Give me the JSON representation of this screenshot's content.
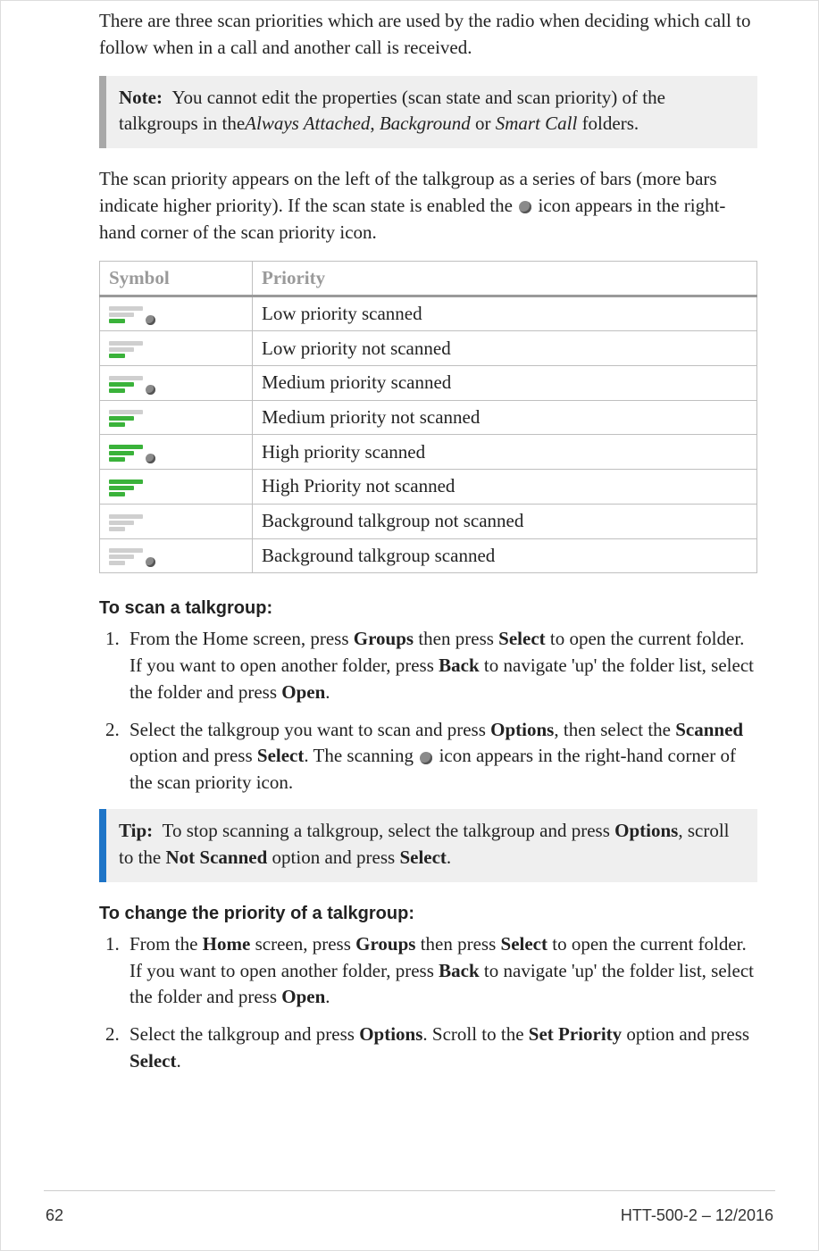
{
  "intro": "There are three scan priorities which are used by the radio when deciding which call to follow when in a call and another call is received.",
  "note": {
    "label": "Note:",
    "text_pre": "You cannot edit the properties (scan state and scan priority) of the talkgroups in the",
    "i1": "Always Attached",
    "sep1": ", ",
    "i2": "Background",
    "sep2": " or ",
    "i3": "Smart Call",
    "text_post": " folders."
  },
  "para2_a": "The scan priority appears on the left of the talkgroup as a series of bars (more bars indicate higher priority). If the scan state is enabled the ",
  "para2_b": " icon appears in the right-hand corner of the scan priority icon.",
  "table": {
    "h1": "Symbol",
    "h2": "Priority",
    "rows": [
      {
        "label": "Low priority scanned"
      },
      {
        "label": "Low priority not scanned"
      },
      {
        "label": "Medium priority scanned"
      },
      {
        "label": "Medium priority not scanned"
      },
      {
        "label": "High priority scanned"
      },
      {
        "label": "High Priority not scanned"
      },
      {
        "label": "Background talkgroup not scanned"
      },
      {
        "label": "Background talkgroup scanned"
      }
    ]
  },
  "scan_heading": "To scan a talkgroup:",
  "scan_steps": {
    "s1_a": "From the Home screen, press ",
    "s1_b1": "Groups",
    "s1_c": " then press ",
    "s1_b2": "Select",
    "s1_d": " to open the current folder. If you want to open another folder, press ",
    "s1_b3": "Back",
    "s1_e": " to navigate 'up' the folder list, select the folder and press ",
    "s1_b4": "Open",
    "s1_f": ".",
    "s2_a": "Select the talkgroup you want to scan and press ",
    "s2_b1": "Options",
    "s2_c": ", then select the ",
    "s2_b2": "Scanned",
    "s2_d": " option and press ",
    "s2_b3": "Select",
    "s2_e": ". The scanning ",
    "s2_f": " icon appears in the right-hand corner of the scan priority icon."
  },
  "tip": {
    "label": "Tip:",
    "a": "To stop scanning a talkgroup, select the talkgroup and press ",
    "b1": "Options",
    "c": ", scroll to the ",
    "b2": "Not Scanned",
    "d": " option and press ",
    "b3": "Select",
    "e": "."
  },
  "prio_heading": "To change the priority of a talkgroup:",
  "prio_steps": {
    "s1_a": "From the ",
    "s1_b0": "Home",
    "s1_aa": " screen, press ",
    "s1_b1": "Groups",
    "s1_c": " then press ",
    "s1_b2": "Select",
    "s1_d": " to open the current folder. If you want to open another folder, press ",
    "s1_b3": "Back",
    "s1_e": " to navigate 'up' the folder list, select the folder and press ",
    "s1_b4": "Open",
    "s1_f": ".",
    "s2_a": "Select the talkgroup and press ",
    "s2_b1": "Options",
    "s2_c": ". Scroll to the ",
    "s2_b2": "Set Priority",
    "s2_d": " option and press ",
    "s2_b3": "Select",
    "s2_e": "."
  },
  "footer": {
    "page": "62",
    "doc": "HTT-500-2 – 12/2016"
  }
}
